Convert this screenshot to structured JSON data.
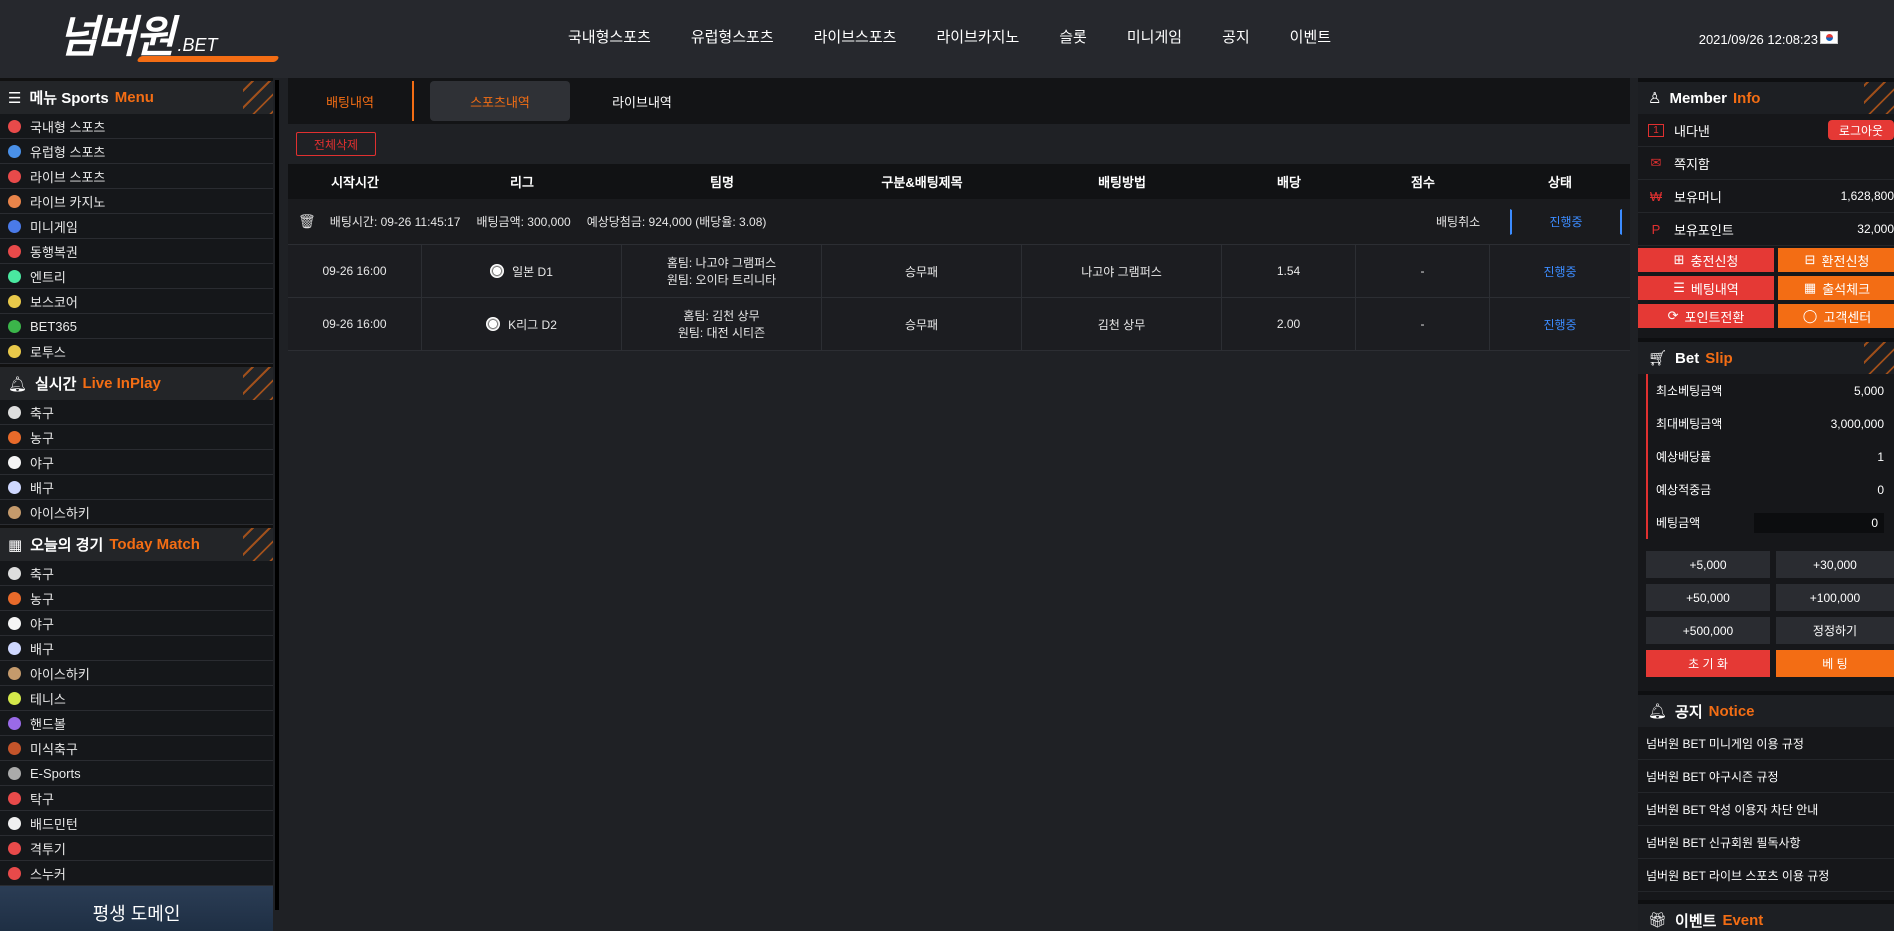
{
  "header": {
    "logo_main": "넘버원",
    "logo_suffix": ".BET",
    "nav": [
      "국내형스포츠",
      "유럽형스포츠",
      "라이브스포츠",
      "라이브카지노",
      "슬롯",
      "미니게임",
      "공지",
      "이벤트"
    ],
    "datetime": "2021/09/26 12:08:23"
  },
  "left": {
    "menu_title": "메뉴 Sports",
    "menu_accent": "Menu",
    "menu_items": [
      {
        "label": "국내형 스포츠",
        "icon": "korean-sports-icon",
        "color": "#e84a4a"
      },
      {
        "label": "유럽형 스포츠",
        "icon": "europe-sports-icon",
        "color": "#4a90e8"
      },
      {
        "label": "라이브 스포츠",
        "icon": "live-sports-icon",
        "color": "#e84a4a"
      },
      {
        "label": "라이브 카지노",
        "icon": "casino-icon",
        "color": "#e8844a"
      },
      {
        "label": "미니게임",
        "icon": "minigame-icon",
        "color": "#4a7ae8"
      },
      {
        "label": "동행복권",
        "icon": "lottery-icon",
        "color": "#e84a4a"
      },
      {
        "label": "엔트리",
        "icon": "entry-icon",
        "color": "#4ae8a0"
      },
      {
        "label": "보스코어",
        "icon": "boscore-icon",
        "color": "#e8c84a"
      },
      {
        "label": "BET365",
        "icon": "bet365-icon",
        "color": "#3bb54a"
      },
      {
        "label": "로투스",
        "icon": "lotus-icon",
        "color": "#e8c84a"
      }
    ],
    "live_title": "실시간",
    "live_accent": "Live InPlay",
    "live_items": [
      {
        "label": "축구",
        "icon": "soccer-icon",
        "color": "#dddddd"
      },
      {
        "label": "농구",
        "icon": "basketball-icon",
        "color": "#e86a2a"
      },
      {
        "label": "야구",
        "icon": "baseball-icon",
        "color": "#f5f5f5"
      },
      {
        "label": "배구",
        "icon": "volleyball-icon",
        "color": "#cfd8ff"
      },
      {
        "label": "아이스하키",
        "icon": "hockey-icon",
        "color": "#c49a6c"
      }
    ],
    "today_title": "오늘의 경기",
    "today_accent": "Today Match",
    "today_items": [
      {
        "label": "축구",
        "icon": "soccer-icon",
        "color": "#dddddd"
      },
      {
        "label": "농구",
        "icon": "basketball-icon",
        "color": "#e86a2a"
      },
      {
        "label": "야구",
        "icon": "baseball-icon",
        "color": "#f5f5f5"
      },
      {
        "label": "배구",
        "icon": "volleyball-icon",
        "color": "#cfd8ff"
      },
      {
        "label": "아이스하키",
        "icon": "hockey-icon",
        "color": "#c49a6c"
      },
      {
        "label": "테니스",
        "icon": "tennis-icon",
        "color": "#d4e84a"
      },
      {
        "label": "핸드볼",
        "icon": "handball-icon",
        "color": "#9a6ae8"
      },
      {
        "label": "미식축구",
        "icon": "football-icon",
        "color": "#c4542a"
      },
      {
        "label": "E-Sports",
        "icon": "esports-icon",
        "color": "#aaaaaa"
      },
      {
        "label": "탁구",
        "icon": "pingpong-icon",
        "color": "#e84a4a"
      },
      {
        "label": "배드민턴",
        "icon": "badminton-icon",
        "color": "#f0f0f0"
      },
      {
        "label": "격투기",
        "icon": "fighting-icon",
        "color": "#e84a4a"
      },
      {
        "label": "스누커",
        "icon": "snooker-icon",
        "color": "#e84a4a"
      }
    ],
    "banner_text": "평생 도메인"
  },
  "center": {
    "tabs": [
      "배팅내역",
      "스포츠내역",
      "라이브내역"
    ],
    "delete_all": "전체삭제",
    "columns": [
      "시작시간",
      "리그",
      "팀명",
      "구분&배팅제목",
      "배팅방법",
      "배당",
      "점수",
      "상태"
    ],
    "summary": {
      "bet_time": "배팅시간: 09-26 11:45:17",
      "bet_amount": "배팅금액: 300,000",
      "expected": "예상당첨금: 924,000 (배당율: 3.08)",
      "cancel": "배팅취소",
      "status": "진행중"
    },
    "rows": [
      {
        "time": "09-26 16:00",
        "league": "일본 D1",
        "home": "홈팀: 나고야 그램퍼스",
        "away": "원팀: 오이타 트리니타",
        "type": "승무패",
        "pick": "나고야 그램퍼스",
        "odds": "1.54",
        "score": "-",
        "status": "진행중"
      },
      {
        "time": "09-26 16:00",
        "league": "K리그 D2",
        "home": "홈팀: 김천 상무",
        "away": "원팀: 대전 시티즌",
        "type": "승무패",
        "pick": "김천 상무",
        "odds": "2.00",
        "score": "-",
        "status": "진행중"
      }
    ]
  },
  "right": {
    "member_title": "Member",
    "member_accent": "Info",
    "username": "내다낸",
    "logout": "로그아웃",
    "messages": "쪽지함",
    "money_label": "보유머니",
    "money_value": "1,628,800",
    "points_label": "보유포인트",
    "points_value": "32,000",
    "buttons": [
      "충전신청",
      "환전신청",
      "베팅내역",
      "출석체크",
      "포인트전환",
      "고객센터"
    ],
    "slip_title": "Bet",
    "slip_accent": "Slip",
    "slip_rows": [
      {
        "label": "최소베팅금액",
        "value": "5,000"
      },
      {
        "label": "최대베팅금액",
        "value": "3,000,000"
      },
      {
        "label": "예상배당률",
        "value": "1"
      },
      {
        "label": "예상적중금",
        "value": "0"
      }
    ],
    "bet_amount_label": "베팅금액",
    "bet_amount_value": "0",
    "amounts": [
      "+5,000",
      "+30,000",
      "+50,000",
      "+100,000",
      "+500,000",
      "정정하기"
    ],
    "reset": "초 기 화",
    "bet": "베 팅",
    "notice_title": "공지",
    "notice_accent": "Notice",
    "notices": [
      "넘버원 BET 미니게임 이용 규정",
      "넘버원 BET 야구시즌 규정",
      "넘버원 BET 악성 이용자 차단 안내",
      "넘버원 BET 신규회원 필독사항",
      "넘버원 BET 라이브 스포츠 이용 규정"
    ],
    "event_title": "이벤트",
    "event_accent": "Event"
  },
  "colors": {
    "accent": "#f36d14",
    "red": "#e53935",
    "blue": "#3c8cff",
    "bg": "#1f2125"
  }
}
